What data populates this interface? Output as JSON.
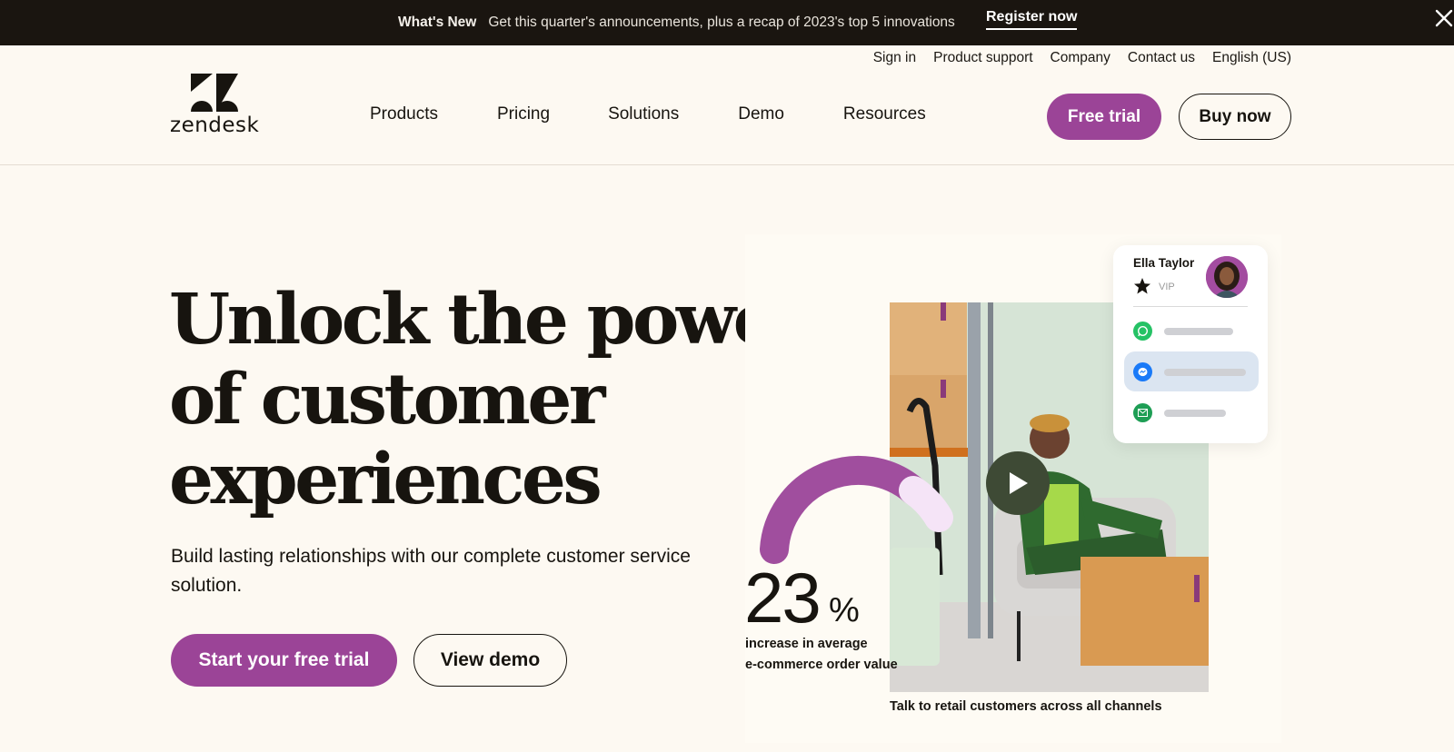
{
  "announcement": {
    "label": "What's New",
    "message": "Get this quarter's announcements, plus a recap of 2023's top 5 innovations",
    "link": "Register now",
    "close_icon": "close-icon"
  },
  "header": {
    "logo_text": "zendesk",
    "utility_links": [
      "Sign in",
      "Product support",
      "Company",
      "Contact us",
      "English (US)"
    ],
    "nav": [
      "Products",
      "Pricing",
      "Solutions",
      "Demo",
      "Resources"
    ],
    "free_trial": "Free trial",
    "buy_now": "Buy now"
  },
  "hero": {
    "headline_lines": [
      "Unlock the power",
      "of customer",
      "experiences"
    ],
    "subtext": "Build lasting relationships with our complete customer service solution.",
    "cta_primary": "Start your free trial",
    "cta_secondary": "View demo"
  },
  "visual": {
    "stat_value": "23",
    "stat_unit": "%",
    "stat_label_lines": [
      "increase in average",
      "e-commerce order value"
    ],
    "caption": "Talk to retail customers across all channels",
    "play_icon": "play-icon",
    "gauge_fraction": 0.8
  },
  "contact_card": {
    "name": "Ella Taylor",
    "badge": "VIP",
    "channels": [
      {
        "icon": "whatsapp-icon",
        "color": "#25c265",
        "active": false
      },
      {
        "icon": "messenger-icon",
        "color": "#1a7af8",
        "active": true
      },
      {
        "icon": "email-icon",
        "color": "#1e9e55",
        "active": false
      }
    ]
  },
  "colors": {
    "brand_purple": "#9b4497",
    "announcement_bg": "#1a1510",
    "page_bg": "#fdf9f2"
  }
}
